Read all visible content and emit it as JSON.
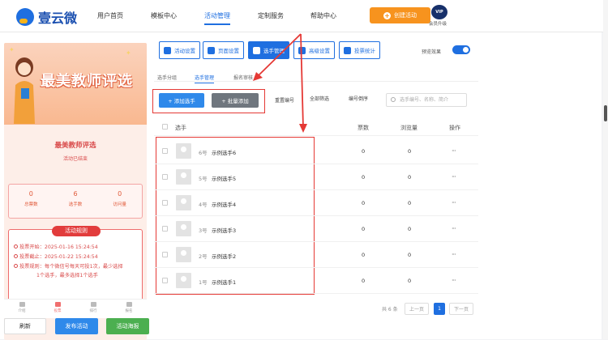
{
  "header": {
    "logo_text": "壹云微",
    "nav": [
      "用户首页",
      "模板中心",
      "活动管理",
      "定制服务",
      "帮助中心"
    ],
    "active_nav": "活动管理",
    "create_label": "创建活动",
    "vip_badge": "VIP",
    "vip_label": "会员升级"
  },
  "preview": {
    "banner_title": "最美教师评选",
    "activity_title": "最美教师评选",
    "activity_status": "活动已结束",
    "stats": [
      {
        "value": "0",
        "label": "总票数"
      },
      {
        "value": "6",
        "label": "选手数"
      },
      {
        "value": "0",
        "label": "访问量"
      }
    ],
    "rules_title": "活动规则",
    "rules": [
      "投票开始：2025-01-16 15:24:54",
      "投票截止：2025-01-22 15:24:54",
      "投票规则：每个微信号每天可投1次，最少选择",
      "1个选手，最多选择1个选手"
    ],
    "tabs": [
      "介绍",
      "投票",
      "排行",
      "报名"
    ],
    "active_tab": "投票"
  },
  "bottom_buttons": {
    "refresh": "刷新",
    "publish": "发布活动",
    "poster": "活动海报"
  },
  "toolbar": {
    "items": [
      "活动设置",
      "页面设置",
      "选手管理",
      "高级设置",
      "投票统计"
    ],
    "active": "选手管理",
    "preview_toggle_label": "预览效果",
    "preview_toggle_on": true
  },
  "subtabs": {
    "items": [
      "选手分组",
      "选手管理",
      "报名审核"
    ],
    "active": "选手管理"
  },
  "actions": {
    "add": "+ 添加选手",
    "batch_add": "+ 批量添加",
    "renumber": "重置编号",
    "filter_all": "全部筛选",
    "sort_number": "编号倒序",
    "search_placeholder": "选手编号、名称、简介"
  },
  "table": {
    "headers": {
      "name": "选手",
      "votes": "票数",
      "views": "浏览量",
      "actions": "操作"
    },
    "rows": [
      {
        "number": "6号",
        "name": "示例选手6",
        "votes": "0",
        "views": "0",
        "more": "···"
      },
      {
        "number": "5号",
        "name": "示例选手5",
        "votes": "0",
        "views": "0",
        "more": "···"
      },
      {
        "number": "4号",
        "name": "示例选手4",
        "votes": "0",
        "views": "0",
        "more": "···"
      },
      {
        "number": "3号",
        "name": "示例选手3",
        "votes": "0",
        "views": "0",
        "more": "···"
      },
      {
        "number": "2号",
        "name": "示例选手2",
        "votes": "0",
        "views": "0",
        "more": "···"
      },
      {
        "number": "1号",
        "name": "示例选手1",
        "votes": "0",
        "views": "0",
        "more": "···"
      }
    ]
  },
  "pagination": {
    "total": "共 6 条",
    "prev": "上一页",
    "current": "1",
    "next": "下一页"
  },
  "colors": {
    "accent": "#1f6fe0",
    "highlight_box": "#e53935",
    "create_button": "#f7931e"
  }
}
